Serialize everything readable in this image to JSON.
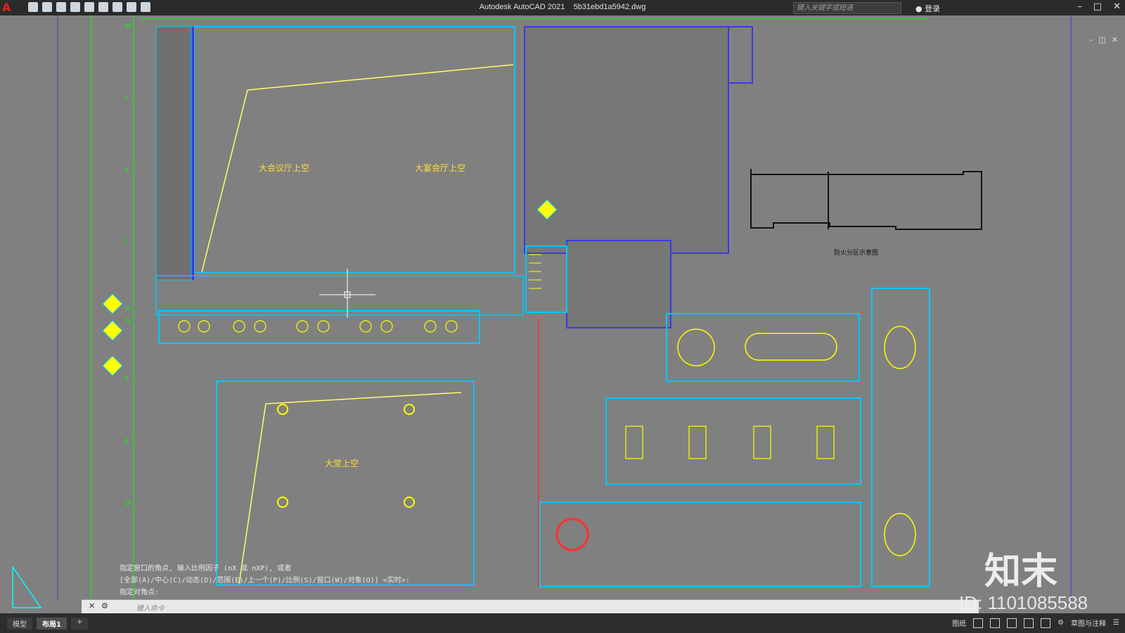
{
  "app": {
    "title": "Autodesk AutoCAD 2021",
    "file": "5b31ebd1a5942.dwg"
  },
  "search": {
    "placeholder": "键入关键字或短语"
  },
  "login": {
    "label": "登录"
  },
  "drawing": {
    "labels": [
      {
        "text": "大会议厅上空"
      },
      {
        "text": "大宴会厅上空"
      },
      {
        "text": "大堂上空"
      },
      {
        "text": "防火分区示意图"
      }
    ],
    "grid_labels": [
      "M",
      "L",
      "K",
      "J",
      "H",
      "G",
      "F",
      "E",
      "D"
    ]
  },
  "command": {
    "history": [
      "指定窗口的角点, 输入比例因子 (nX 或 nXP), 或者",
      "[全部(A)/中心(C)/动态(D)/范围(E)/上一个(P)/比例(S)/窗口(W)/对象(O)] <实时>:",
      "指定对角点:"
    ],
    "input_placeholder": "键入命令"
  },
  "tabs": [
    "模型",
    "布局1"
  ],
  "statusbar": {
    "model_label": "图纸",
    "workspace": "草图与注释"
  },
  "watermark": {
    "logo": "知末",
    "id": "ID: 1101085588"
  },
  "colors": {
    "canvas": "#808080",
    "wall": "#00c8ff",
    "furniture": "#ffff00",
    "grid": "#00ff00",
    "accent": "#e02020"
  }
}
